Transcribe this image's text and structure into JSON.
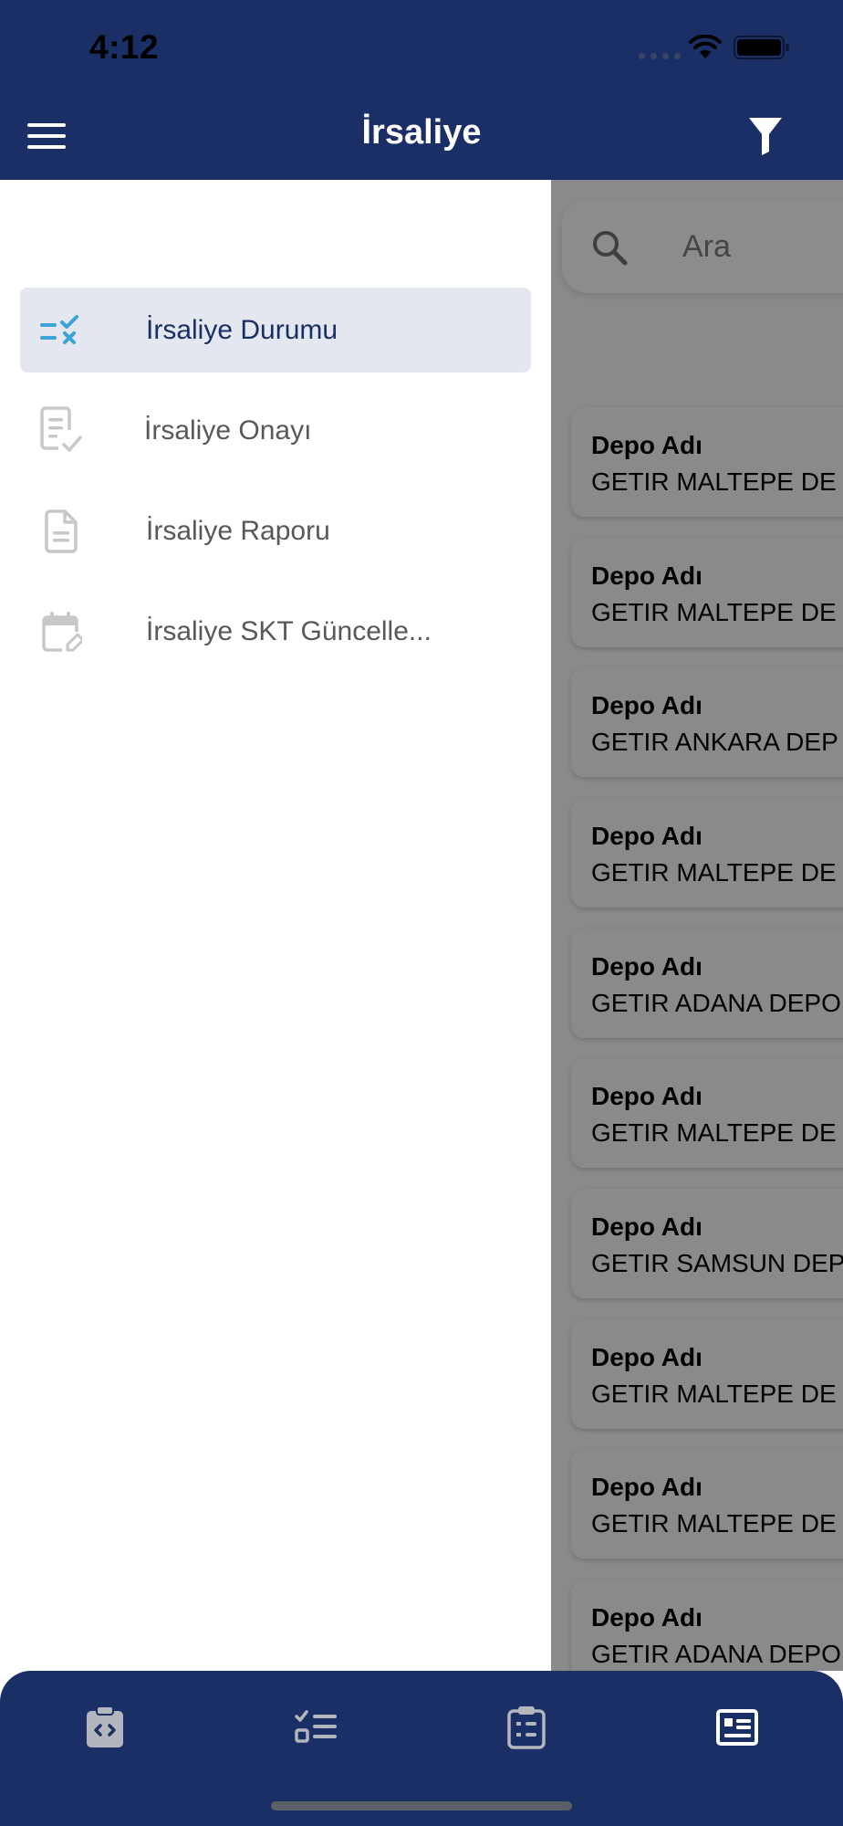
{
  "status_bar": {
    "time": "4:12"
  },
  "header": {
    "title": "İrsaliye",
    "menu_icon": "hamburger-menu-icon",
    "filter_icon": "filter-funnel-icon"
  },
  "search": {
    "placeholder": "Ara",
    "icon": "search-icon"
  },
  "drawer": {
    "items": [
      {
        "label": "İrsaliye Durumu",
        "icon": "list-check-x-icon",
        "active": true
      },
      {
        "label": "İrsaliye Onayı",
        "icon": "document-check-icon",
        "active": false
      },
      {
        "label": "İrsaliye Raporu",
        "icon": "document-icon",
        "active": false
      },
      {
        "label": "İrsaliye SKT Güncelle...",
        "icon": "calendar-edit-icon",
        "active": false
      }
    ]
  },
  "list": {
    "cards": [
      {
        "label": "Depo Adı",
        "value": "GETIR MALTEPE DE"
      },
      {
        "label": "Depo Adı",
        "value": "GETIR MALTEPE DE"
      },
      {
        "label": "Depo Adı",
        "value": "GETIR ANKARA DEP"
      },
      {
        "label": "Depo Adı",
        "value": "GETIR MALTEPE DE"
      },
      {
        "label": "Depo Adı",
        "value": "GETIR ADANA DEPO"
      },
      {
        "label": "Depo Adı",
        "value": "GETIR MALTEPE DE"
      },
      {
        "label": "Depo Adı",
        "value": "GETIR SAMSUN DEP"
      },
      {
        "label": "Depo Adı",
        "value": "GETIR MALTEPE DE"
      },
      {
        "label": "Depo Adı",
        "value": "GETIR MALTEPE DE"
      },
      {
        "label": "Depo Adı",
        "value": "GETIR ADANA DEPO"
      }
    ]
  },
  "tabbar": {
    "tabs": [
      {
        "icon": "clipboard-code-icon",
        "active": false
      },
      {
        "icon": "checklist-icon",
        "active": false
      },
      {
        "icon": "clipboard-numbered-icon",
        "active": false
      },
      {
        "icon": "list-article-icon",
        "active": true
      }
    ]
  },
  "colors": {
    "primary": "#1a2f66",
    "accent": "#3aa3d8",
    "drawer_active_bg": "#e4e7ef",
    "overlay": "#8a8a8a"
  }
}
